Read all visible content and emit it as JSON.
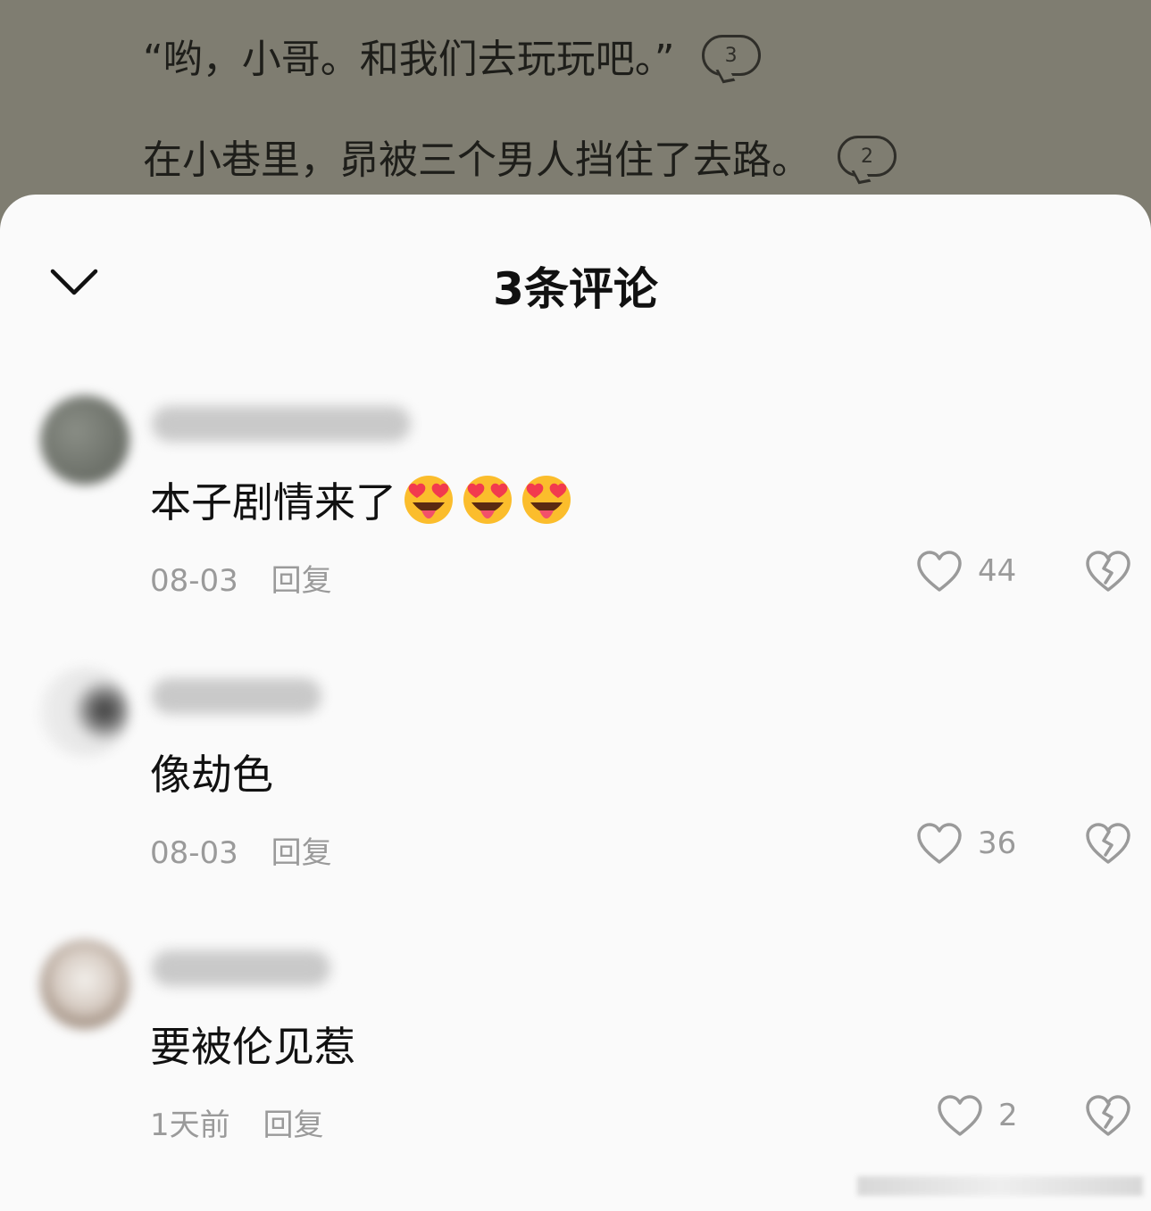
{
  "reader": {
    "line1": {
      "text": "“哟，小哥。和我们去玩玩吧。”",
      "comment_count": "3"
    },
    "line2": {
      "text": "在小巷里，昴被三个男人挡住了去路。",
      "comment_count": "2"
    }
  },
  "sheet": {
    "title": "3条评论",
    "collapse_icon": "chevron-down-icon"
  },
  "comments": [
    {
      "text": "本子剧情来了",
      "emoji": [
        "star-struck-tongue-emoji",
        "star-struck-tongue-emoji",
        "star-struck-tongue-emoji"
      ],
      "date": "08-03",
      "reply": "回复",
      "likes": "44",
      "avatar_color": "#6d7068"
    },
    {
      "text": "像劫色",
      "date": "08-03",
      "reply": "回复",
      "likes": "36",
      "avatar_color": "#dadada"
    },
    {
      "text": "要被伦见惹",
      "date": "1天前",
      "reply": "回复",
      "likes": "2",
      "avatar_color": "#b9aca2"
    }
  ],
  "colors": {
    "backdrop": "#7f7d71",
    "sheet": "#fafafa",
    "meta_text": "#9a9a9a",
    "heart_emoji": "#f23a4e",
    "emoji_face": "#fbbd2c"
  }
}
